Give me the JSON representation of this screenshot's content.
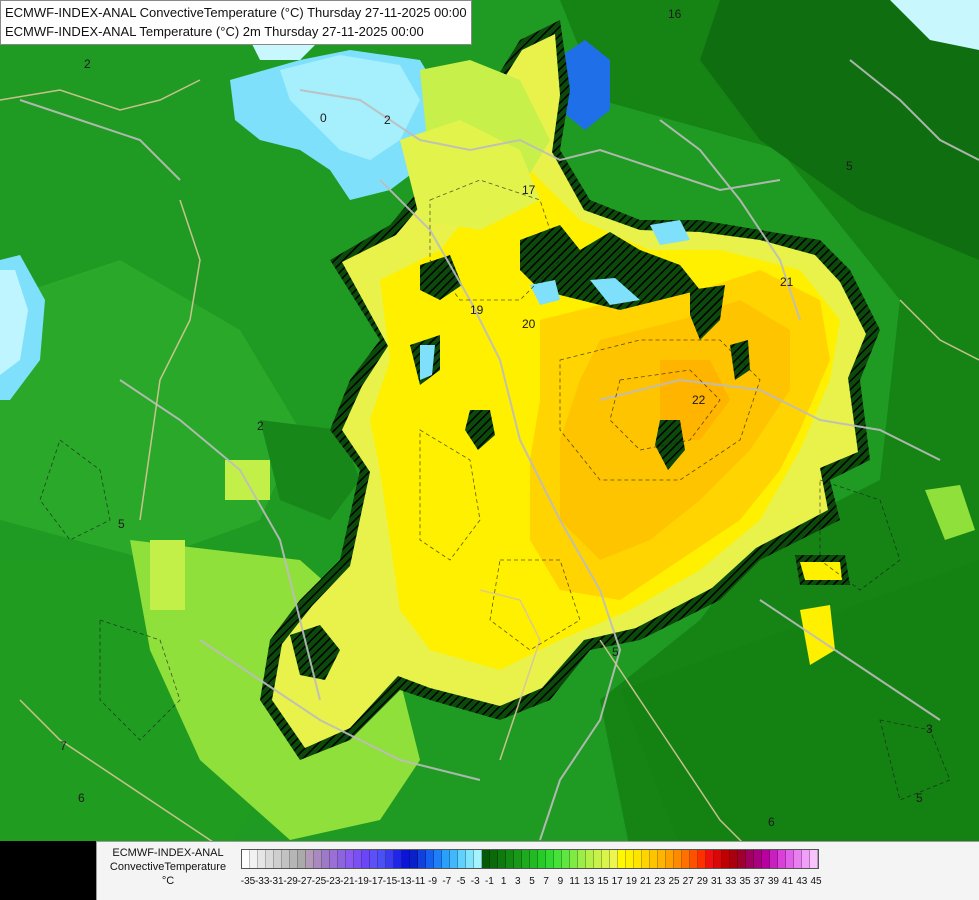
{
  "title_lines": [
    "ECMWF-INDEX-ANAL ConvectiveTemperature (°C) Thursday 27-11-2025 00:00",
    "ECMWF-INDEX-ANAL Temperature (°C) 2m Thursday 27-11-2025 00:00"
  ],
  "legend": {
    "lines": [
      "ECMWF-INDEX-ANAL",
      "ConvectiveTemperature",
      "°C"
    ],
    "tick_labels": [
      "-35",
      "-33",
      "-31",
      "-29",
      "-27",
      "-25",
      "-23",
      "-21",
      "-19",
      "-17",
      "-15",
      "-13",
      "-11",
      "-9",
      "-7",
      "-5",
      "-3",
      "-1",
      "1",
      "3",
      "5",
      "7",
      "9",
      "11",
      "13",
      "15",
      "17",
      "19",
      "21",
      "23",
      "25",
      "27",
      "29",
      "31",
      "33",
      "35",
      "37",
      "39",
      "41",
      "43",
      "45"
    ],
    "colors": [
      "#ffffff",
      "#f2f2f2",
      "#e6e6e6",
      "#dadada",
      "#cecece",
      "#c2c2c2",
      "#b6b6b6",
      "#aaaaaa",
      "#b39ab8",
      "#a88ac0",
      "#9c7ac8",
      "#9a70d8",
      "#8d64e0",
      "#8a5af0",
      "#7a50f5",
      "#6a46f8",
      "#5e50f8",
      "#4a50f4",
      "#3a3cf0",
      "#1f26e8",
      "#0b14d8",
      "#0a20c8",
      "#1040e0",
      "#1660f0",
      "#1e80f8",
      "#2aa0fb",
      "#40b8fb",
      "#60d0fc",
      "#80e4fc",
      "#a6f2fd",
      "#055a05",
      "#0a6a0a",
      "#0e7a0e",
      "#138a13",
      "#189a18",
      "#1eaa1e",
      "#22ba22",
      "#28ca28",
      "#30da30",
      "#46e23a",
      "#60e640",
      "#80ea44",
      "#9cee46",
      "#b4f048",
      "#c8f24a",
      "#daf44c",
      "#ecf64e",
      "#fff800",
      "#fff000",
      "#ffe400",
      "#ffd400",
      "#ffc400",
      "#ffb400",
      "#ffa000",
      "#ff8a00",
      "#ff7000",
      "#ff5000",
      "#ff3000",
      "#f01010",
      "#d80808",
      "#c00000",
      "#a80010",
      "#a00030",
      "#a00060",
      "#a80080",
      "#b800a0",
      "#c820c0",
      "#d840d8",
      "#e060e8",
      "#e880f0",
      "#f0a0f8",
      "#f8c4fc"
    ]
  },
  "contour_labels": [
    {
      "text": "16"
    },
    {
      "text": "0"
    },
    {
      "text": "5"
    },
    {
      "text": "2"
    },
    {
      "text": "17"
    },
    {
      "text": "20"
    },
    {
      "text": "19"
    },
    {
      "text": "22"
    },
    {
      "text": "21"
    },
    {
      "text": "2"
    },
    {
      "text": "5"
    },
    {
      "text": "2"
    },
    {
      "text": "5"
    },
    {
      "text": "6"
    },
    {
      "text": "3"
    },
    {
      "text": "5"
    },
    {
      "text": "7"
    },
    {
      "text": "6"
    }
  ]
}
